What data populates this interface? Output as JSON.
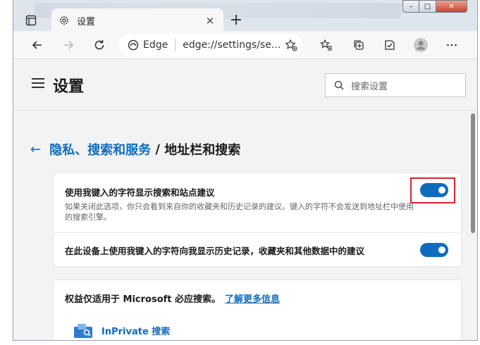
{
  "tab": {
    "title": "设置",
    "close_label": "×",
    "new_tab_label": "+"
  },
  "window_controls": {
    "minimize": "–",
    "maximize": "□",
    "close": "✕"
  },
  "address_bar": {
    "edge_label": "Edge",
    "url": "edge://settings/se..."
  },
  "header": {
    "title": "设置",
    "search_placeholder": "搜索设置"
  },
  "breadcrumb": {
    "parent": "隐私、搜索和服务",
    "separator": " / ",
    "current": "地址栏和搜索"
  },
  "settings": [
    {
      "title": "使用我键入的字符显示搜索和站点建议",
      "description": "如果关闭此选项，你只会看到来自你的收藏夹和历史记录的建议。键入的字符不会发送到地址栏中使用的搜索引擎。",
      "enabled": true
    },
    {
      "title": "在此设备上使用我键入的字符向我显示历史记录，收藏夹和其他数据中的建议",
      "enabled": true
    }
  ],
  "notice": {
    "text": "权益仅适用于 Microsoft 必应搜索。",
    "link": "了解更多信息"
  },
  "engine": {
    "name": "InPrivate 搜索"
  },
  "colors": {
    "accent": "#0f6cbd",
    "highlight": "#d9232e"
  }
}
